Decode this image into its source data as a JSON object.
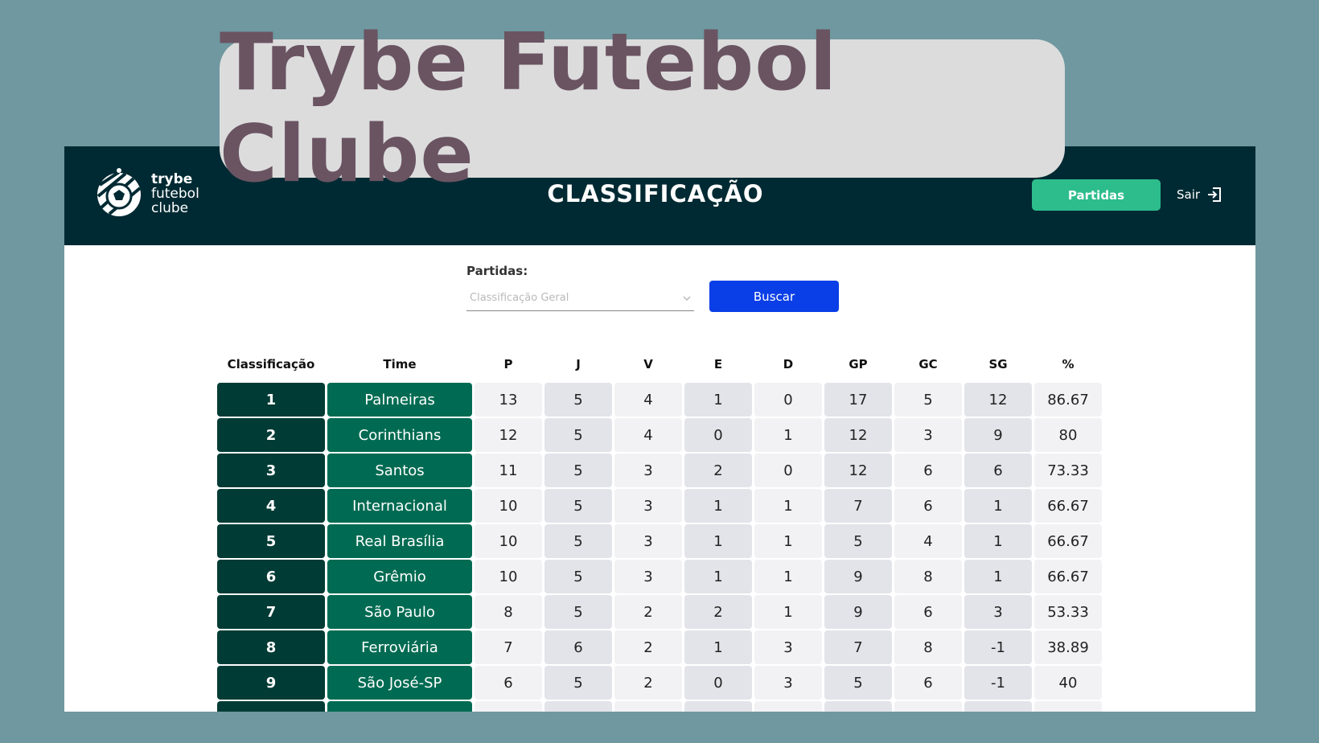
{
  "banner": {
    "title": "Trybe Futebol Clube"
  },
  "header": {
    "logo": {
      "line1": "trybe",
      "line2": "futebol",
      "line3": "clube"
    },
    "page_title": "CLASSIFICAÇÃO",
    "matches_button": "Partidas",
    "logout_label": "Sair",
    "logout_icon": "logout-icon"
  },
  "filter": {
    "label": "Partidas:",
    "selected": "Classificação Geral",
    "search_button": "Buscar"
  },
  "colors": {
    "page_bg": "#6f98a0",
    "header_bg": "#002a33",
    "matches_button": "#2dbd8c",
    "search_button": "#0a3ee6",
    "rank_cell": "#003b35",
    "team_cell": "#006b52",
    "banner_bg": "#dcdcdc",
    "banner_text": "#6a5462"
  },
  "table": {
    "headers": [
      "Classificação",
      "Time",
      "P",
      "J",
      "V",
      "E",
      "D",
      "GP",
      "GC",
      "SG",
      "%"
    ],
    "rows": [
      [
        "1",
        "Palmeiras",
        "13",
        "5",
        "4",
        "1",
        "0",
        "17",
        "5",
        "12",
        "86.67"
      ],
      [
        "2",
        "Corinthians",
        "12",
        "5",
        "4",
        "0",
        "1",
        "12",
        "3",
        "9",
        "80"
      ],
      [
        "3",
        "Santos",
        "11",
        "5",
        "3",
        "2",
        "0",
        "12",
        "6",
        "6",
        "73.33"
      ],
      [
        "4",
        "Internacional",
        "10",
        "5",
        "3",
        "1",
        "1",
        "7",
        "6",
        "1",
        "66.67"
      ],
      [
        "5",
        "Real Brasília",
        "10",
        "5",
        "3",
        "1",
        "1",
        "5",
        "4",
        "1",
        "66.67"
      ],
      [
        "6",
        "Grêmio",
        "10",
        "5",
        "3",
        "1",
        "1",
        "9",
        "8",
        "1",
        "66.67"
      ],
      [
        "7",
        "São Paulo",
        "8",
        "5",
        "2",
        "2",
        "1",
        "9",
        "6",
        "3",
        "53.33"
      ],
      [
        "8",
        "Ferroviária",
        "7",
        "6",
        "2",
        "1",
        "3",
        "7",
        "8",
        "-1",
        "38.89"
      ],
      [
        "9",
        "São José-SP",
        "6",
        "5",
        "2",
        "0",
        "3",
        "5",
        "6",
        "-1",
        "40"
      ],
      [
        "",
        "",
        "",
        "",
        "",
        "",
        "",
        "",
        "",
        "",
        ""
      ]
    ]
  }
}
